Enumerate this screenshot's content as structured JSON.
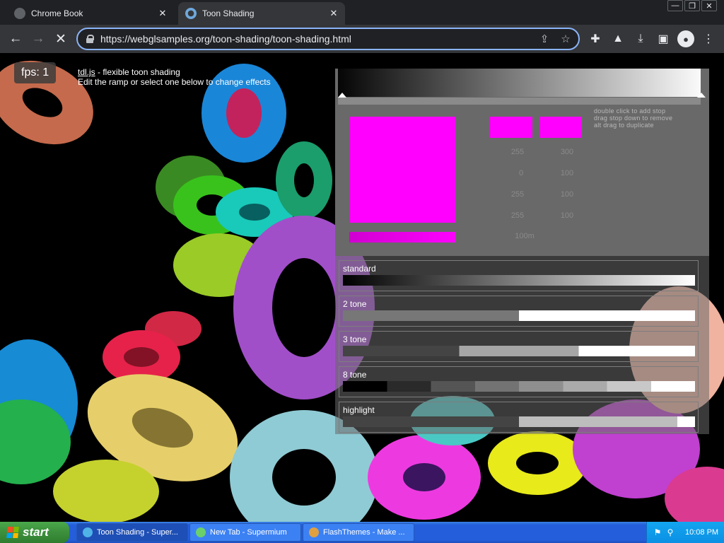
{
  "browser": {
    "tabs": [
      {
        "title": "Chrome Book",
        "active": false
      },
      {
        "title": "Toon Shading",
        "active": true
      }
    ],
    "url": "https://webglsamples.org/toon-shading/toon-shading.html",
    "icons": [
      "back-icon",
      "forward-icon",
      "stop-icon",
      "share-icon",
      "star-icon",
      "extensions-icon",
      "labs-icon",
      "download-icon",
      "side-panel-icon",
      "profile-icon",
      "menu-icon"
    ]
  },
  "page": {
    "fps": "fps: 1",
    "info_link": "tdl.js",
    "info_suffix": " - flexible toon shading",
    "info_line2": "Edit the ramp or select one below to change effects"
  },
  "editor": {
    "help_lines": [
      "double click to add stop",
      "drag stop down to remove",
      "alt drag to duplicate"
    ],
    "swatch_color": "#ff00ff",
    "values_left": [
      "255",
      "0",
      "255",
      "255"
    ],
    "values_right": [
      "300",
      "100",
      "100",
      "100"
    ],
    "position": "100m"
  },
  "presets": [
    {
      "name": "standard",
      "stops": [
        [
          "#000000",
          "#ffffff"
        ]
      ],
      "type": "gradient"
    },
    {
      "name": "2 tone",
      "stops": [
        [
          0,
          0.5,
          "#777777"
        ],
        [
          0.5,
          1,
          "#ffffff"
        ]
      ],
      "type": "steps"
    },
    {
      "name": "3 tone",
      "stops": [
        [
          0,
          0.33,
          "#444444"
        ],
        [
          0.33,
          0.67,
          "#a6a6a6"
        ],
        [
          0.67,
          1,
          "#ffffff"
        ]
      ],
      "type": "steps"
    },
    {
      "name": "8 tone",
      "stops": [
        [
          0,
          0.125,
          "#000000"
        ],
        [
          0.125,
          0.25,
          "#2a2a2a"
        ],
        [
          0.25,
          0.375,
          "#555555"
        ],
        [
          0.375,
          0.5,
          "#737373"
        ],
        [
          0.5,
          0.625,
          "#8f8f8f"
        ],
        [
          0.625,
          0.75,
          "#aaaaaa"
        ],
        [
          0.75,
          0.875,
          "#c8c8c8"
        ],
        [
          0.875,
          1,
          "#ffffff"
        ]
      ],
      "type": "steps"
    },
    {
      "name": "highlight",
      "stops": [
        [
          0,
          0.5,
          "#444444"
        ],
        [
          0.5,
          0.95,
          "#bdbdbd"
        ],
        [
          0.95,
          1,
          "#ffffff"
        ]
      ],
      "type": "steps"
    }
  ],
  "taskbar": {
    "start_label": "start",
    "items": [
      {
        "label": "Toon Shading - Super...",
        "active": true
      },
      {
        "label": "New Tab - Supermium",
        "active": false
      },
      {
        "label": "FlashThemes - Make ...",
        "active": false
      }
    ],
    "clock": "10:08 PM"
  }
}
